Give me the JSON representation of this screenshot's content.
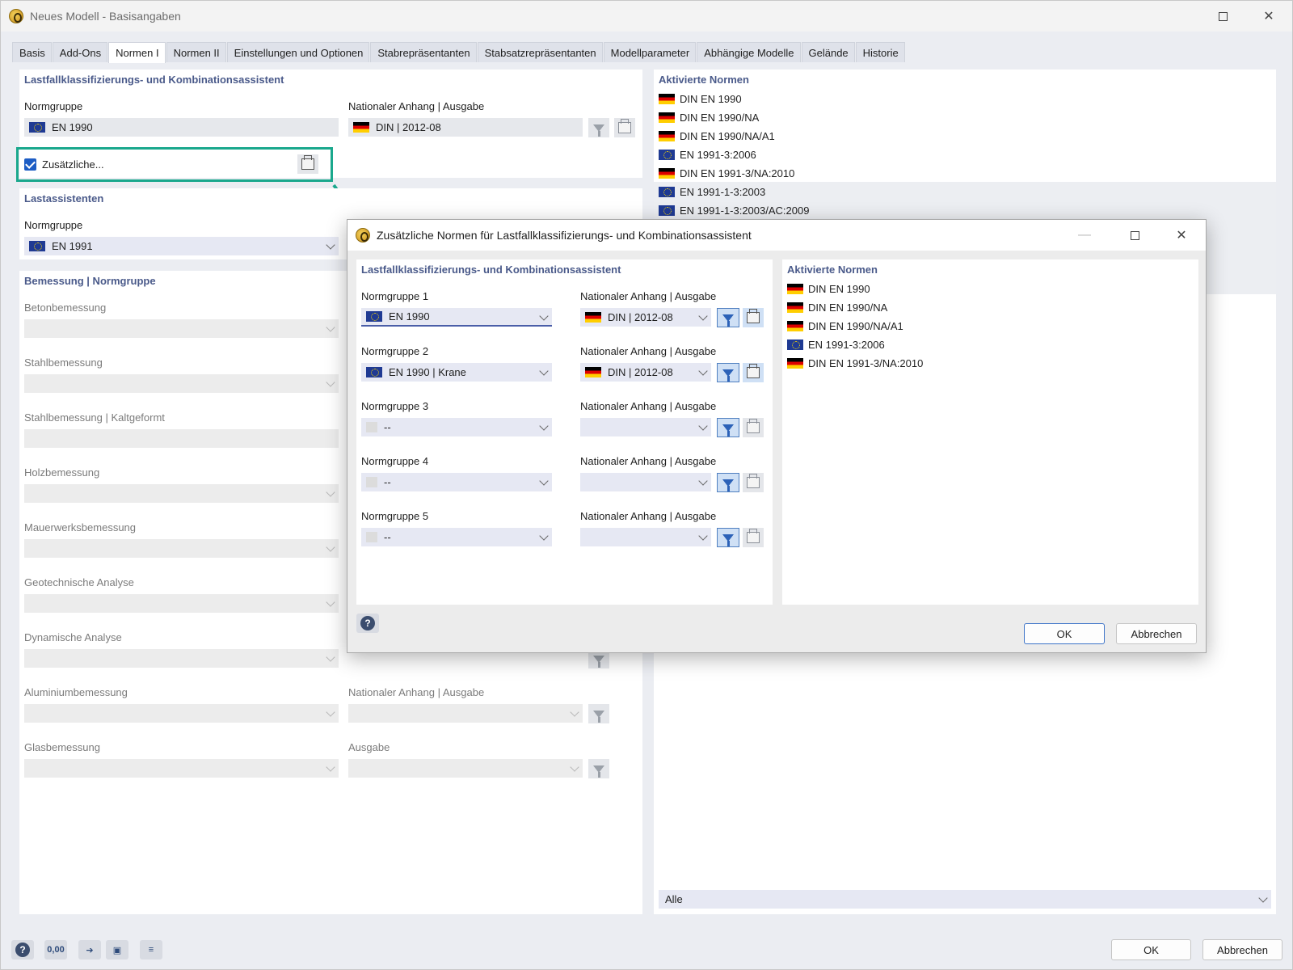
{
  "window": {
    "title": "Neues Modell - Basisangaben"
  },
  "tabs": [
    "Basis",
    "Add-Ons",
    "Normen I",
    "Normen II",
    "Einstellungen und Optionen",
    "Stabrepräsentanten",
    "Stabsatzrepräsentanten",
    "Modellparameter",
    "Abhängige Modelle",
    "Gelände",
    "Historie"
  ],
  "lk": {
    "title": "Lastfallklassifizierungs- und Kombinationsassistent",
    "normgruppe_label": "Normgruppe",
    "normgruppe_value": "EN 1990",
    "na_label": "Nationaler Anhang | Ausgabe",
    "na_value": "DIN | 2012-08",
    "zusaetzliche": "Zusätzliche..."
  },
  "lastassistenten": {
    "title": "Lastassistenten",
    "normgruppe_label": "Normgruppe",
    "normgruppe_value": "EN 1991"
  },
  "bemessung": {
    "title": "Bemessung | Normgruppe",
    "rows": [
      {
        "label": "Betonbemessung"
      },
      {
        "label": "Stahlbemessung"
      },
      {
        "label": "Stahlbemessung | Kaltgeformt"
      },
      {
        "label": "Holzbemessung"
      },
      {
        "label": "Mauerwerksbemessung"
      },
      {
        "label": "Geotechnische Analyse"
      },
      {
        "label": "Dynamische Analyse"
      },
      {
        "label": "Aluminiumbemessung",
        "right_label": "Nationaler Anhang | Ausgabe"
      },
      {
        "label": "Glasbemessung",
        "right_label": "Ausgabe"
      }
    ]
  },
  "aktivierte": {
    "title": "Aktivierte Normen",
    "items": [
      {
        "flag": "de",
        "text": "DIN EN 1990"
      },
      {
        "flag": "de",
        "text": "DIN EN 1990/NA"
      },
      {
        "flag": "de",
        "text": "DIN EN 1990/NA/A1"
      },
      {
        "flag": "eu",
        "text": "EN 1991-3:2006"
      },
      {
        "flag": "de",
        "text": "DIN EN 1991-3/NA:2010"
      },
      {
        "flag": "eu",
        "text": "EN 1991-1-3:2003"
      },
      {
        "flag": "eu",
        "text": "EN 1991-1-3:2003/AC:2009"
      }
    ],
    "filter_value": "Alle"
  },
  "dialog": {
    "title": "Zusätzliche Normen für Lastfallklassifizierungs- und Kombinationsassistent",
    "section_title": "Lastfallklassifizierungs- und Kombinationsassistent",
    "groups": [
      {
        "label": "Normgruppe 1",
        "flag": "eu",
        "value": "EN 1990",
        "na_label": "Nationaler Anhang | Ausgabe",
        "na_flag": "de",
        "na_value": "DIN | 2012-08"
      },
      {
        "label": "Normgruppe 2",
        "flag": "eu",
        "value": "EN 1990 | Krane",
        "na_label": "Nationaler Anhang | Ausgabe",
        "na_flag": "de",
        "na_value": "DIN | 2012-08"
      },
      {
        "label": "Normgruppe 3",
        "flag": "blank",
        "value": "--",
        "na_label": "Nationaler Anhang | Ausgabe",
        "na_flag": "",
        "na_value": ""
      },
      {
        "label": "Normgruppe 4",
        "flag": "blank",
        "value": "--",
        "na_label": "Nationaler Anhang | Ausgabe",
        "na_flag": "",
        "na_value": ""
      },
      {
        "label": "Normgruppe 5",
        "flag": "blank",
        "value": "--",
        "na_label": "Nationaler Anhang | Ausgabe",
        "na_flag": "",
        "na_value": ""
      }
    ],
    "aktivierte_title": "Aktivierte Normen",
    "aktivierte_items": [
      {
        "flag": "de",
        "text": "DIN EN 1990"
      },
      {
        "flag": "de",
        "text": "DIN EN 1990/NA"
      },
      {
        "flag": "de",
        "text": "DIN EN 1990/NA/A1"
      },
      {
        "flag": "eu",
        "text": "EN 1991-3:2006"
      },
      {
        "flag": "de",
        "text": "DIN EN 1991-3/NA:2010"
      }
    ],
    "ok": "OK",
    "cancel": "Abbrechen"
  },
  "footer": {
    "ok": "OK",
    "cancel": "Abbrechen",
    "units_icon_text": "0,00"
  },
  "colors": {
    "accent": "#1aa88d",
    "section_title": "#4a5a8a",
    "primary_border": "#3c73c8"
  }
}
